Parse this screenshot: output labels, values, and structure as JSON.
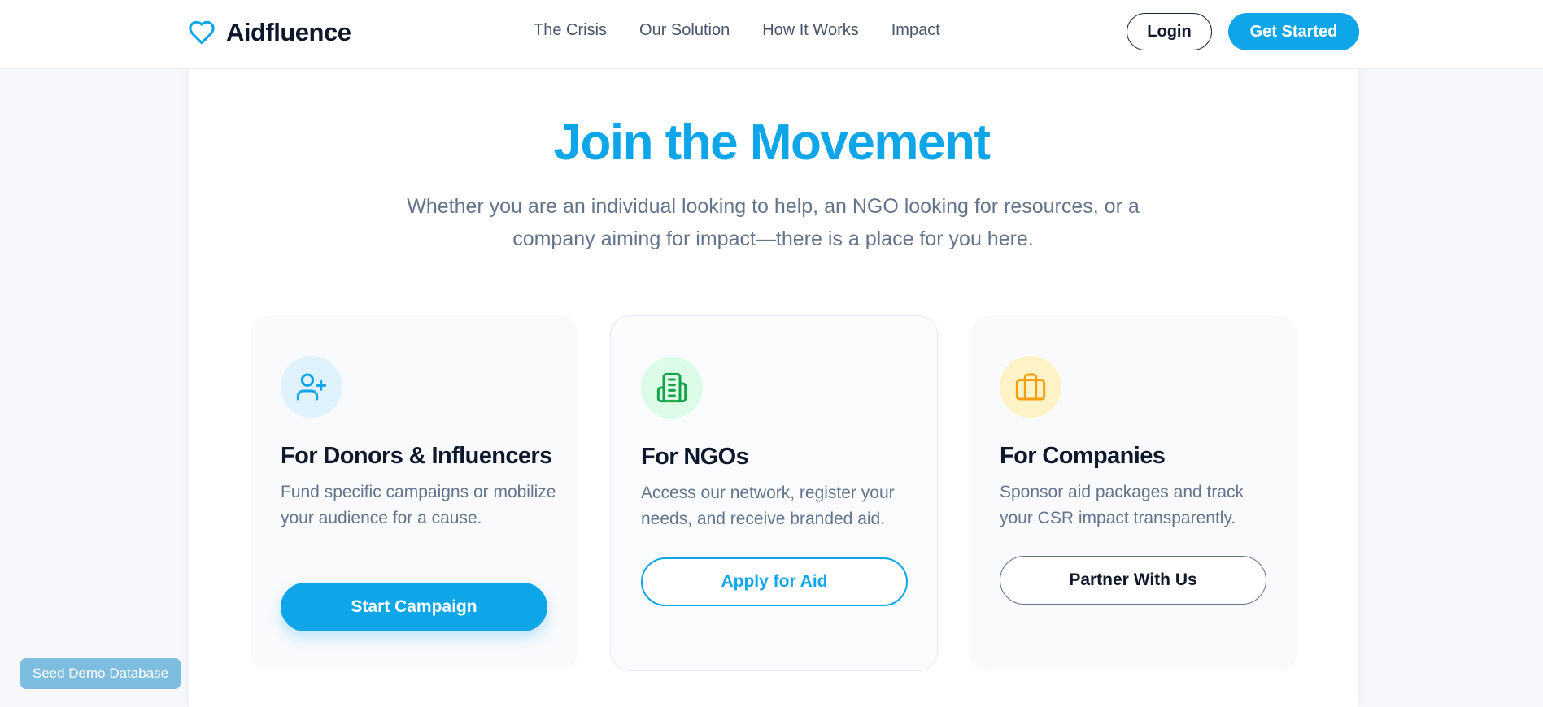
{
  "header": {
    "brand": "Aidfluence",
    "nav": [
      "The Crisis",
      "Our Solution",
      "How It Works",
      "Impact"
    ],
    "login_label": "Login",
    "get_started_label": "Get Started"
  },
  "hero": {
    "title": "Join the Movement",
    "subtitle": "Whether you are an individual looking to help, an NGO looking for resources, or a company aiming for impact—there is a place for you here."
  },
  "cards": [
    {
      "icon": "user-plus-icon",
      "title": "For Donors & Influencers",
      "description": "Fund specific campaigns or mobilize your audience for a cause.",
      "button": "Start Campaign"
    },
    {
      "icon": "building-icon",
      "title": "For NGOs",
      "description": "Access our network, register your needs, and receive branded aid.",
      "button": "Apply for Aid"
    },
    {
      "icon": "briefcase-icon",
      "title": "For Companies",
      "description": "Sponsor aid packages and track your CSR impact transparently.",
      "button": "Partner With Us"
    }
  ],
  "seed_button": "Seed Demo Database",
  "colors": {
    "accent": "#0ea5e9",
    "donor_icon_bg": "#e0f2fe",
    "ngo_icon_bg": "#dcfce7",
    "ngo_icon": "#16a34a",
    "company_icon_bg": "#fef3c7",
    "company_icon": "#f59e0b"
  }
}
